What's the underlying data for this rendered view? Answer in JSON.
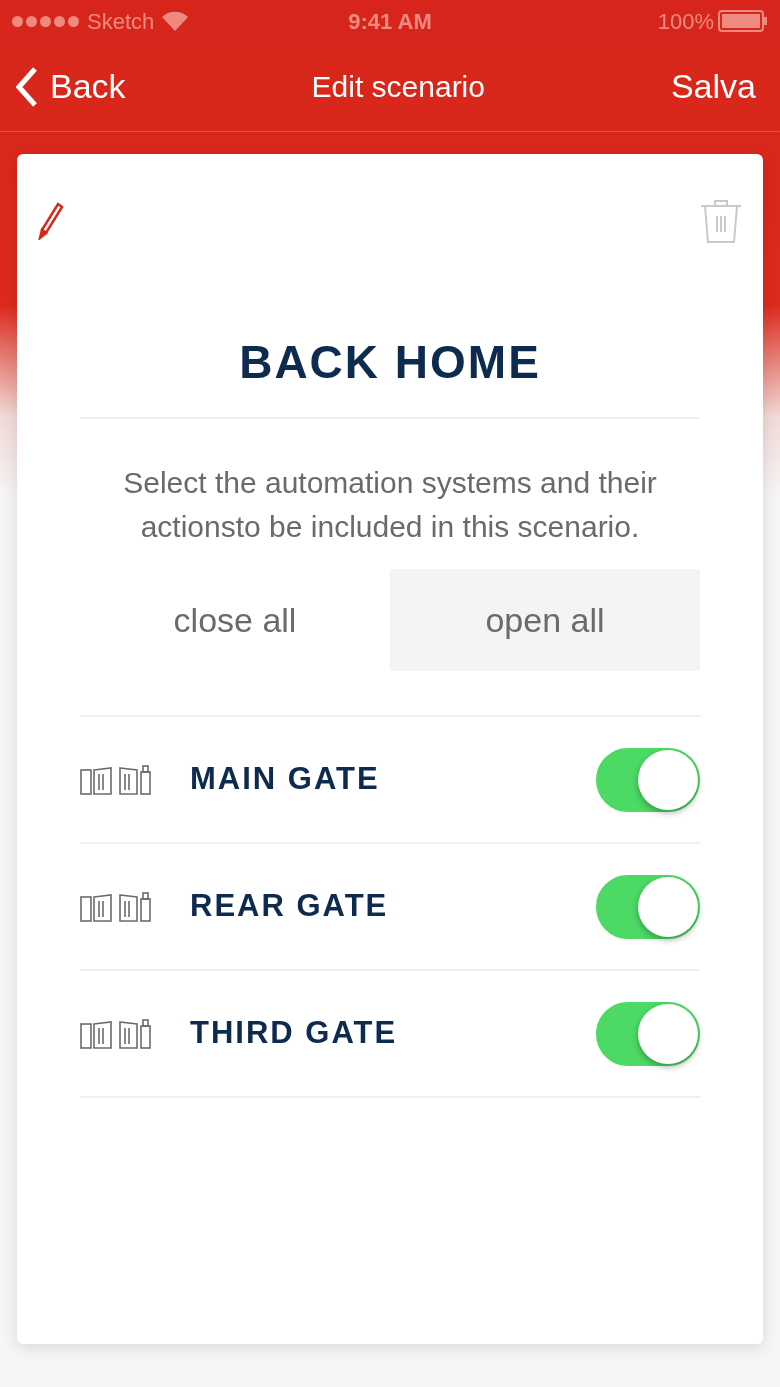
{
  "status_bar": {
    "carrier": "Sketch",
    "time": "9:41 AM",
    "battery": "100%"
  },
  "nav": {
    "back": "Back",
    "title": "Edit scenario",
    "action": "Salva"
  },
  "scenario": {
    "name": "BACK HOME",
    "description": "Select the automation systems and their actionsto be included in this scenario."
  },
  "segments": [
    {
      "label": "close all",
      "selected": false
    },
    {
      "label": "open all",
      "selected": true
    }
  ],
  "devices": [
    {
      "name": "MAIN GATE",
      "on": true
    },
    {
      "name": "REAR GATE",
      "on": true
    },
    {
      "name": "THIRD GATE",
      "on": true
    }
  ]
}
